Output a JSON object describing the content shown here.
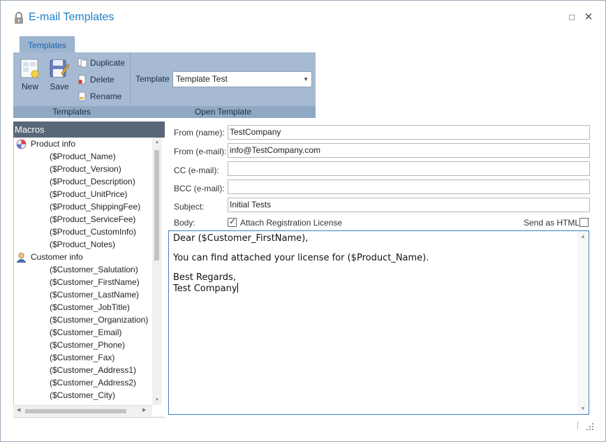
{
  "window": {
    "title": "E-mail Templates",
    "icons": {
      "app": "lock-icon",
      "minimize": "minimize-icon",
      "close": "close-icon"
    },
    "controls": {
      "minimize": "□",
      "close": "✕"
    }
  },
  "ribbon": {
    "tab": "Templates",
    "groups": {
      "templates": "Templates",
      "open_template": "Open Template"
    },
    "buttons": {
      "new": "New",
      "save": "Save",
      "duplicate": "Duplicate",
      "delete": "Delete",
      "rename": "Rename"
    },
    "template_label": "Template",
    "template_selected": "Template Test"
  },
  "macros": {
    "header": "Macros",
    "groups": [
      {
        "name": "Product info",
        "icon": "product-info-icon",
        "items": [
          "($Product_Name)",
          "($Product_Version)",
          "($Product_Description)",
          "($Product_UnitPrice)",
          "($Product_ShippingFee)",
          "($Product_ServiceFee)",
          "($Product_CustomInfo)",
          "($Product_Notes)"
        ]
      },
      {
        "name": "Customer info",
        "icon": "customer-info-icon",
        "items": [
          "($Customer_Salutation)",
          "($Customer_FirstName)",
          "($Customer_LastName)",
          "($Customer_JobTitle)",
          "($Customer_Organization)",
          "($Customer_Email)",
          "($Customer_Phone)",
          "($Customer_Fax)",
          "($Customer_Address1)",
          "($Customer_Address2)",
          "($Customer_City)"
        ]
      }
    ]
  },
  "form": {
    "from_name": {
      "label": "From (name):",
      "value": "TestCompany"
    },
    "from_email": {
      "label": "From (e-mail):",
      "value": "info@TestCompany.com"
    },
    "cc": {
      "label": "CC (e-mail):",
      "value": ""
    },
    "bcc": {
      "label": "BCC (e-mail):",
      "value": ""
    },
    "subject": {
      "label": "Subject:",
      "value": "Initial Tests"
    },
    "body_label": "Body:",
    "attach_license": {
      "label": "Attach Registration License",
      "checked": true
    },
    "send_as_html": {
      "label": "Send as HTML",
      "checked": false
    },
    "body_lines": [
      "Dear ($Customer_FirstName),",
      "",
      "You can find attached your license for ($Product_Name).",
      "",
      "Best Regards,",
      "Test Company"
    ]
  }
}
